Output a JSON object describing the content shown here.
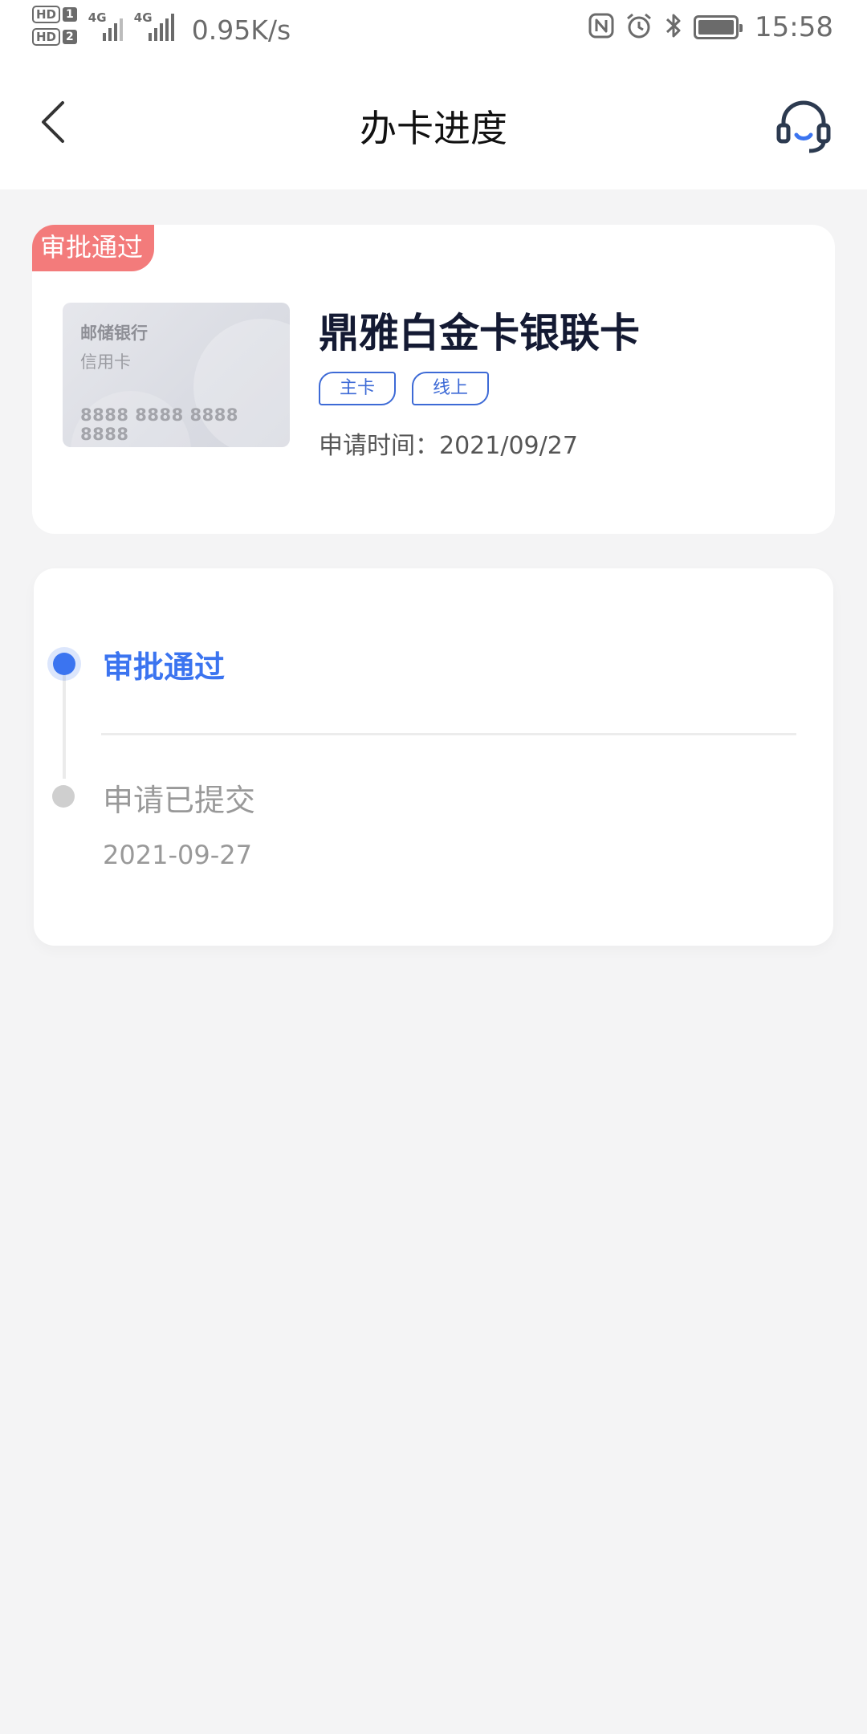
{
  "status_bar": {
    "hd1": "HD",
    "sim1": "1",
    "hd2": "HD",
    "sim2": "2",
    "net1": "4G",
    "net2": "4G",
    "speed": "0.95K/s",
    "time": "15:58",
    "icons": [
      "nfc-icon",
      "alarm-icon",
      "bluetooth-icon",
      "battery-icon"
    ]
  },
  "nav": {
    "title": "办卡进度",
    "back_icon": "chevron-left-icon",
    "service_icon": "headset-icon"
  },
  "card_panel": {
    "ribbon": "审批通过",
    "card_image": {
      "bank": "邮储银行",
      "type": "信用卡",
      "number": "8888 8888 8888 8888"
    },
    "card_name": "鼎雅白金卡银联卡",
    "tags": [
      "主卡",
      "线上"
    ],
    "apply_time": "申请时间：2021/09/27"
  },
  "progress": {
    "steps": [
      {
        "label": "审批通过",
        "date": ""
      },
      {
        "label": "申请已提交",
        "date": "2021-09-27"
      }
    ]
  },
  "colors": {
    "accent": "#3b74f0",
    "ribbon": "#f37b7b",
    "tag_border": "#3d6ad6",
    "background": "#f4f4f5"
  }
}
